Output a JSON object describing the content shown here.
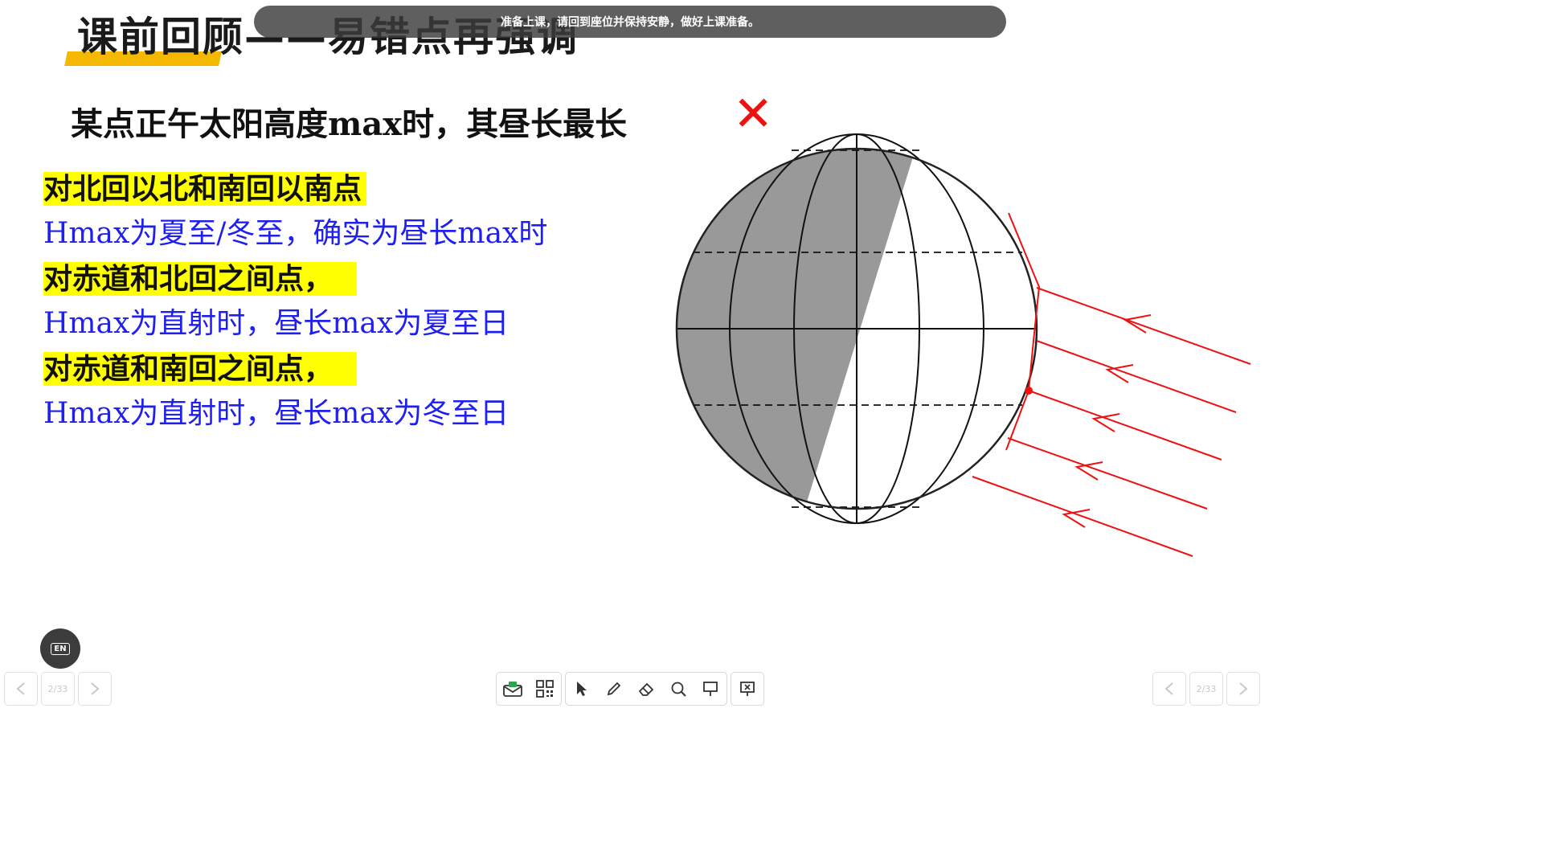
{
  "slide": {
    "title": "课前回顾——易错点再强调",
    "heading": "某点正午太阳高度max时，其昼长最长",
    "wrong_mark": "✕",
    "lines": [
      {
        "text": "对北回以北和南回以南点",
        "style": "highlight"
      },
      {
        "text": "Hmax为夏至/冬至，确实为昼长max时",
        "style": "blue"
      },
      {
        "text": "对赤道和北回之间点，",
        "style": "highlight"
      },
      {
        "text": "Hmax为直射时，昼长max为夏至日",
        "style": "blue"
      },
      {
        "text": "对赤道和南回之间点，",
        "style": "highlight"
      },
      {
        "text": "Hmax为直射时，昼长max为冬至日",
        "style": "blue"
      }
    ]
  },
  "notice": "准备上课，请回到座位并保持安静，做好上课准备。",
  "language_button": "EN",
  "pager_left": {
    "page": "2/33",
    "prev_icon": "chevron-left-icon",
    "next_icon": "chevron-right-icon"
  },
  "pager_right": {
    "page": "2/33",
    "prev_icon": "chevron-left-icon",
    "next_icon": "chevron-right-icon"
  },
  "toolbar": {
    "tools": [
      "envelope-icon",
      "qr-grid-icon",
      "pointer-icon",
      "pen-icon",
      "eraser-icon",
      "magnifier-icon",
      "projector-icon",
      "exit-slideshow-icon"
    ]
  },
  "colors": {
    "accent": "#f5b800",
    "highlight": "#ffff00",
    "blue_text": "#1f1ff0",
    "wrong": "#ee1111",
    "sun_rays": "#ee1111",
    "night": "#999999"
  }
}
